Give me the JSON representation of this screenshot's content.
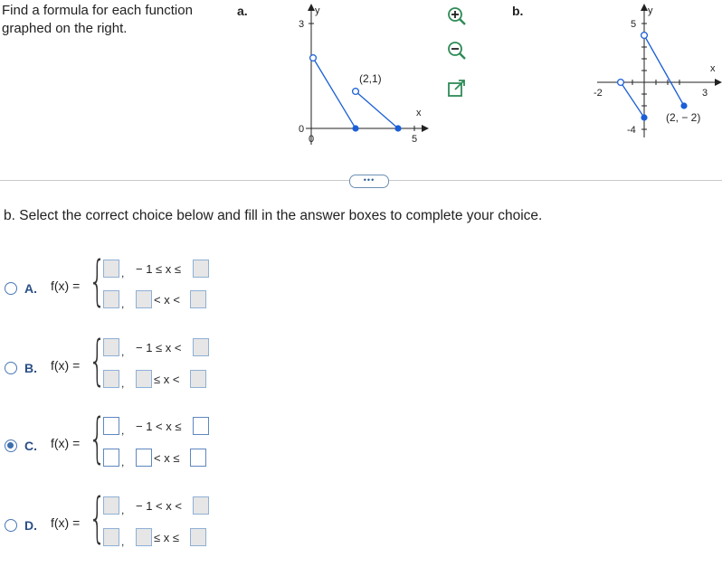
{
  "instructions": "Find a formula for each function graphed on the right.",
  "graph_a": {
    "label": "a.",
    "y_axis": "y",
    "x_axis": "x",
    "tick_y": "3",
    "tick_y0": "0",
    "tick_x0": "0",
    "tick_x": "5",
    "point_label": "(2,1)"
  },
  "graph_b": {
    "label": "b.",
    "y_axis": "y",
    "x_axis": "x",
    "tick_y_top": "5",
    "tick_y_bottom": "-4",
    "tick_x_left": "-2",
    "tick_x_right": "3",
    "point_label": "(2, − 2)"
  },
  "tools": {
    "zoom_in": "zoom-in-icon",
    "zoom_out": "zoom-out-icon",
    "popout": "popout-icon"
  },
  "more_button": "•••",
  "question": "b. Select the correct choice below and fill in the answer boxes to complete your choice.",
  "choices": [
    {
      "letter": "A.",
      "fx": "f(x) =",
      "row1": "− 1 ≤ x ≤",
      "row2": "< x <"
    },
    {
      "letter": "B.",
      "fx": "f(x) =",
      "row1": "− 1 ≤ x <",
      "row2": "≤ x <"
    },
    {
      "letter": "C.",
      "fx": "f(x) =",
      "row1": "− 1 < x ≤",
      "row2": "< x ≤",
      "selected": true
    },
    {
      "letter": "D.",
      "fx": "f(x) =",
      "row1": "− 1 < x <",
      "row2": "≤ x ≤"
    }
  ],
  "comma": ","
}
